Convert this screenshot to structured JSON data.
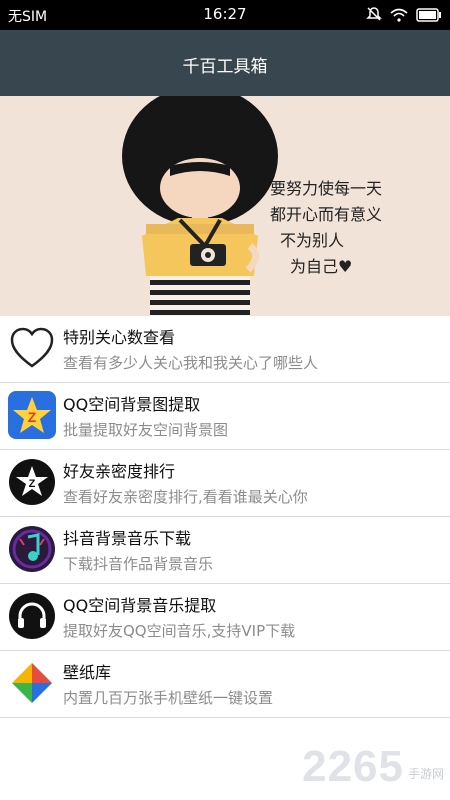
{
  "status_bar": {
    "carrier": "无SIM",
    "time": "16:27",
    "icons": [
      "mute-icon",
      "wifi-icon",
      "battery-icon"
    ]
  },
  "app_bar": {
    "title": "千百工具箱"
  },
  "banner": {
    "lines": [
      "要努力使每一天",
      "都开心而有意义",
      "不为别人",
      "为自己♥"
    ]
  },
  "items": [
    {
      "title": "特别关心数查看",
      "subtitle": "查看有多少人关心我和我关心了哪些人",
      "icon": "heart-outline-icon"
    },
    {
      "title": "QQ空间背景图提取",
      "subtitle": "批量提取好友空间背景图",
      "icon": "qzone-star-icon"
    },
    {
      "title": "好友亲密度排行",
      "subtitle": "查看好友亲密度排行,看看谁最关心你",
      "icon": "friends-star-icon"
    },
    {
      "title": "抖音背景音乐下载",
      "subtitle": "下载抖音作品背景音乐",
      "icon": "music-note-icon"
    },
    {
      "title": "QQ空间背景音乐提取",
      "subtitle": "提取好友QQ空间音乐,支持VIP下载",
      "icon": "headphones-icon"
    },
    {
      "title": "壁纸库",
      "subtitle": "内置几百万张手机壁纸一键设置",
      "icon": "wallpaper-icon"
    }
  ],
  "watermark": {
    "number": "2265",
    "text": "手游网"
  }
}
